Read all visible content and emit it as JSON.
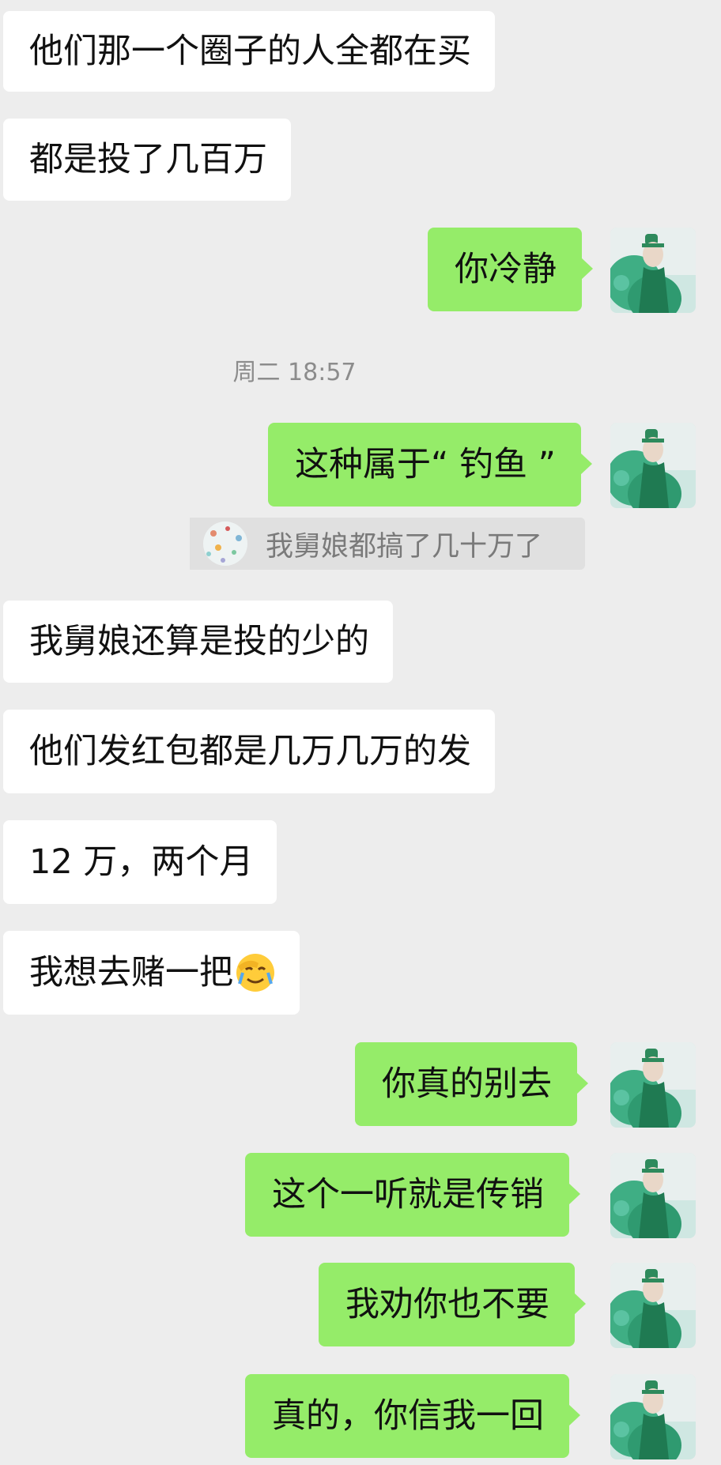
{
  "messages": [
    {
      "side": "left",
      "text": "他们那一个圈子的人全都在买"
    },
    {
      "side": "left",
      "text": "都是投了几百万"
    },
    {
      "side": "right",
      "text": "你冷静"
    },
    {
      "side": "right",
      "text": "这种属于“ 钓鱼 ”"
    },
    {
      "side": "left",
      "text": "我舅娘还算是投的少的"
    },
    {
      "side": "left",
      "text": "他们发红包都是几万几万的发"
    },
    {
      "side": "left",
      "text": "12 万，两个月"
    },
    {
      "side": "left",
      "text": "我想去赌一把",
      "emoji": "face-palm-crying-emoji"
    },
    {
      "side": "right",
      "text": "你真的别去"
    },
    {
      "side": "right",
      "text": "这个一听就是传销"
    },
    {
      "side": "right",
      "text": "我劝你也不要"
    },
    {
      "side": "right",
      "text": "真的，你信我一回"
    }
  ],
  "timestamp": "周二 18:57",
  "quote": {
    "text": "我舅娘都搞了几十万了"
  },
  "colors": {
    "background": "#ededed",
    "right_bubble": "#95ec69",
    "left_bubble": "#ffffff"
  }
}
